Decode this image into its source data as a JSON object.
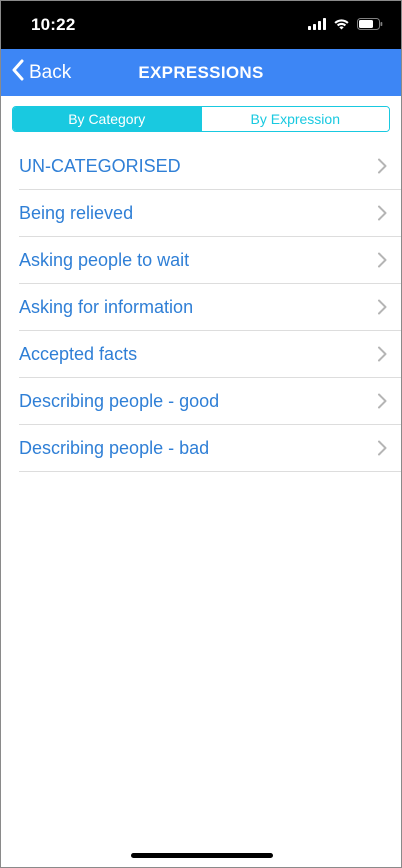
{
  "status_bar": {
    "time": "10:22"
  },
  "nav": {
    "back_label": "Back",
    "title": "EXPRESSIONS",
    "accent_color": "#3d86f5"
  },
  "segmented_control": {
    "segments": [
      "By Category",
      "By Expression"
    ],
    "selected": "By Category",
    "accent_color": "#19c9e0"
  },
  "list": {
    "items": [
      {
        "label": "UN-CATEGORISED"
      },
      {
        "label": "Being relieved"
      },
      {
        "label": "Asking people to wait"
      },
      {
        "label": "Asking for information"
      },
      {
        "label": "Accepted facts"
      },
      {
        "label": "Describing people - good"
      },
      {
        "label": "Describing people - bad"
      }
    ],
    "text_color": "#2f7fd6"
  },
  "icons": [
    "cellular-signal-icon",
    "wifi-icon",
    "battery-icon",
    "chevron-left-icon",
    "chevron-right-icon"
  ]
}
